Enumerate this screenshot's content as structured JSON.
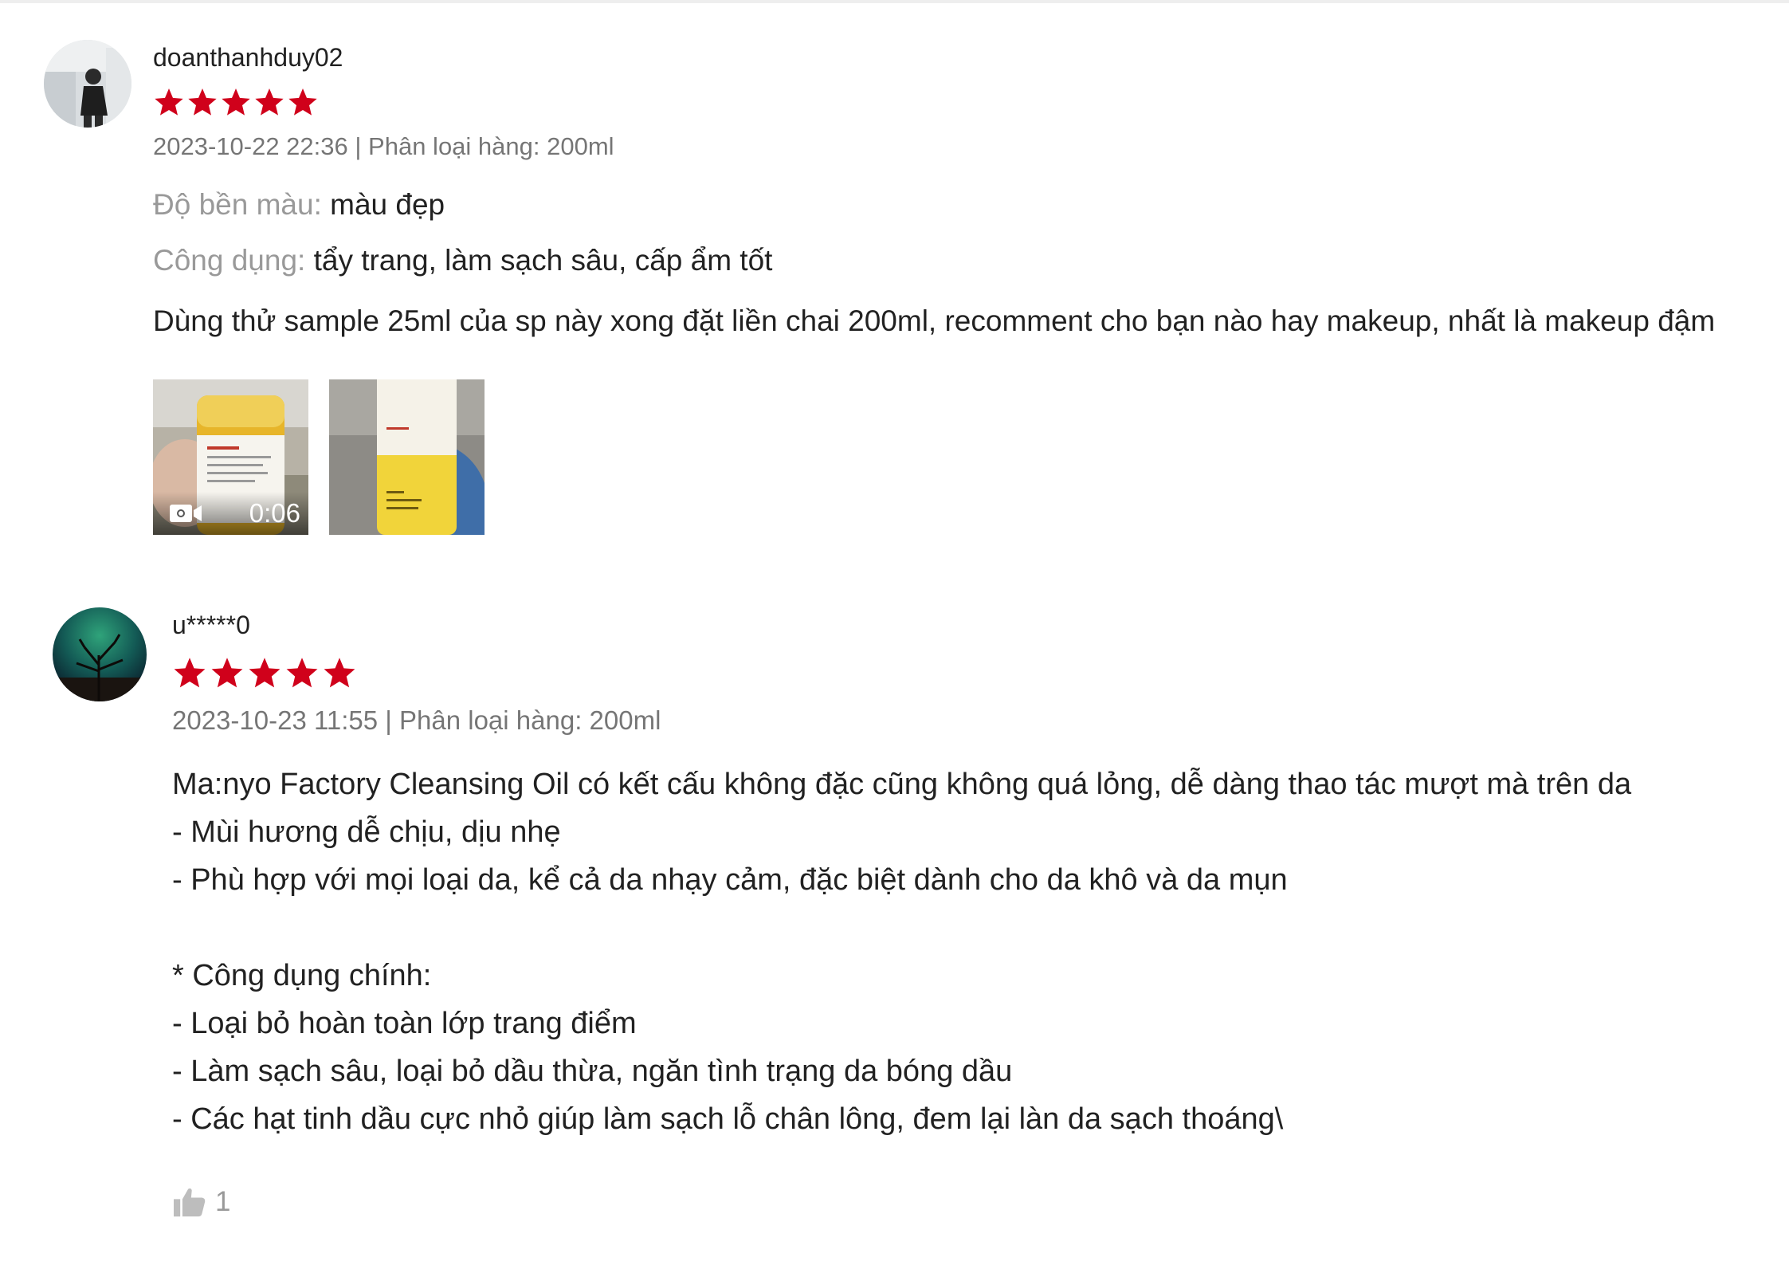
{
  "colors": {
    "star": "#d0011b",
    "muted_text": "#8a8a8a",
    "body_text": "#222222"
  },
  "reviews": [
    {
      "username": "doanthanhduy02",
      "rating": 5,
      "meta": "2023-10-22 22:36 | Phân loại hàng: 200ml",
      "attributes": [
        {
          "label": "Độ bền màu:",
          "value": "màu đẹp"
        },
        {
          "label": "Công dụng:",
          "value": "tẩy trang, làm sạch sâu, cấp ẩm tốt"
        }
      ],
      "comment": "Dùng thử sample 25ml của sp này xong đặt liền chai 200ml, recomment cho bạn nào hay makeup, nhất là makeup đậm",
      "media": [
        {
          "type": "video",
          "duration": "0:06",
          "icon": "video-camera-icon"
        },
        {
          "type": "image"
        }
      ]
    },
    {
      "username": "u*****0",
      "rating": 5,
      "meta": "2023-10-23 11:55 | Phân loại hàng: 200ml",
      "comment_lines": [
        "Ma:nyo Factory Cleansing Oil có kết cấu không đặc cũng không quá lỏng, dễ dàng thao tác mượt mà trên da",
        "- Mùi hương dễ chịu, dịu nhẹ",
        "- Phù hợp với mọi loại da, kể cả da nhạy cảm, đặc biệt dành cho da khô và da mụn",
        "",
        "* Công dụng chính:",
        "- Loại bỏ hoàn toàn lớp trang điểm",
        "- Làm sạch sâu, loại bỏ dầu thừa, ngăn tình trạng da bóng dầu",
        "- Các hạt tinh dầu cực nhỏ giúp làm sạch lỗ chân lông, đem lại làn da sạch thoáng\\"
      ],
      "like_icon": "thumbs-up-icon",
      "like_count": "1"
    }
  ]
}
